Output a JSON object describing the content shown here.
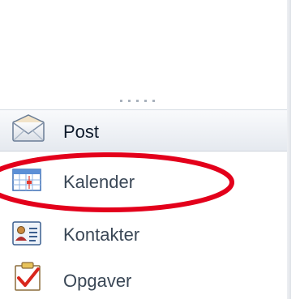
{
  "nav": {
    "items": [
      {
        "key": "post",
        "label": "Post",
        "icon": "mail-icon",
        "selected": true
      },
      {
        "key": "kalender",
        "label": "Kalender",
        "icon": "calendar-icon"
      },
      {
        "key": "kontakter",
        "label": "Kontakter",
        "icon": "contacts-icon"
      },
      {
        "key": "opgaver",
        "label": "Opgaver",
        "icon": "tasks-icon"
      }
    ]
  },
  "annotation": {
    "color": "#e3001b",
    "target": "Kalender"
  }
}
